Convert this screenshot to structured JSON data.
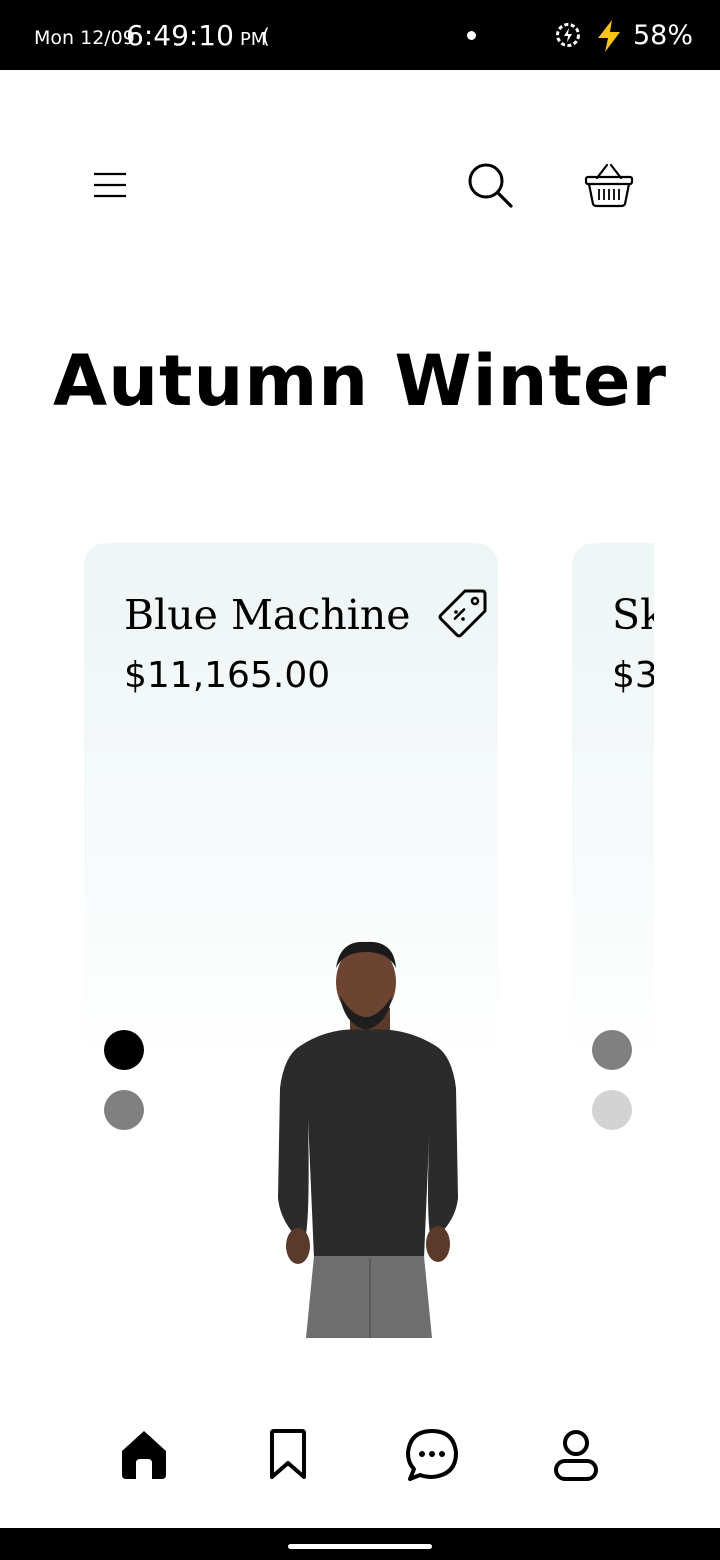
{
  "status_bar": {
    "date": "Mon 12/09",
    "time": "6:49:10",
    "ampm": "PM",
    "extra_glyph": "(",
    "battery": "58%",
    "icons": [
      "notification-dot-icon",
      "data-saver-icon",
      "charging-bolt-icon"
    ]
  },
  "header": {
    "icons": [
      "menu-icon",
      "search-icon",
      "basket-icon"
    ]
  },
  "page": {
    "title": "Autumn Winter"
  },
  "products": [
    {
      "name": "Blue Machine",
      "price": "$11,165.00",
      "swatches": [
        "#000000",
        "#808080"
      ]
    },
    {
      "name": "Sk",
      "price": "$3",
      "swatches": [
        "#808080",
        "#d3d3d3"
      ]
    }
  ],
  "bottom_nav": {
    "items": [
      "home-icon",
      "bookmark-icon",
      "chat-icon",
      "profile-icon"
    ]
  },
  "colors": {
    "card_bg": "#eef5f5",
    "accent": "#000000"
  }
}
